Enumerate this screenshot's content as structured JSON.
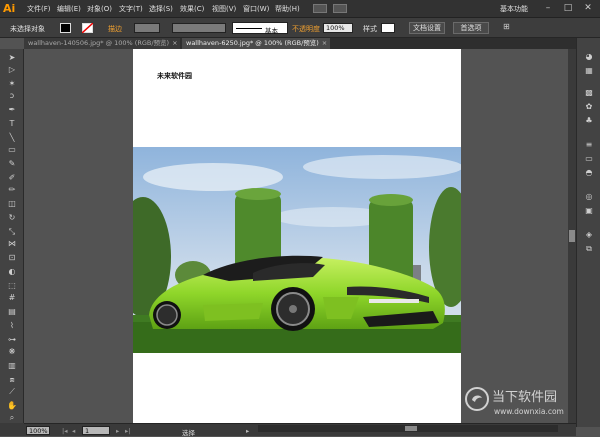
{
  "app": {
    "logo": "Ai",
    "menu": [
      "文件(F)",
      "编辑(E)",
      "对象(O)",
      "文字(T)",
      "选择(S)",
      "效果(C)",
      "视图(V)",
      "窗口(W)",
      "帮助(H)"
    ],
    "workspace": "基本功能",
    "window_buttons": [
      "–",
      "□",
      "✕"
    ]
  },
  "control": {
    "selection": "未选择对象",
    "stroke_label": "描边",
    "brush_label": "基本",
    "opacity_label": "不透明度",
    "opacity_value": "100%",
    "style_label": "样式",
    "doc_setup": "文档设置",
    "prefs": "首选项"
  },
  "tabs": [
    {
      "label": "wallhaven-140506.jpg* @ 100% (RGB/预览)",
      "active": false
    },
    {
      "label": "wallhaven-6250.jpg* @ 100% (RGB/预览)",
      "active": true
    }
  ],
  "artboard": {
    "title": "未来软件园"
  },
  "status": {
    "zoom": "100%",
    "page": "1",
    "tool": "选择"
  },
  "watermark": {
    "name": "当下软件园",
    "url": "www.downxia.com"
  },
  "colors": {
    "accent": "#ff9a00",
    "car": "#8fd62a"
  }
}
